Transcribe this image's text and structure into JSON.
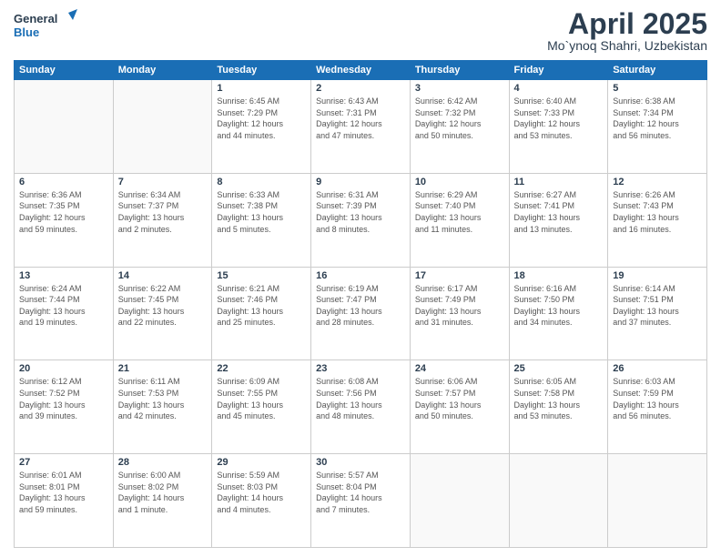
{
  "header": {
    "logo_line1": "General",
    "logo_line2": "Blue",
    "month": "April 2025",
    "location": "Mo`ynoq Shahri, Uzbekistan"
  },
  "weekdays": [
    "Sunday",
    "Monday",
    "Tuesday",
    "Wednesday",
    "Thursday",
    "Friday",
    "Saturday"
  ],
  "weeks": [
    [
      {
        "day": "",
        "info": ""
      },
      {
        "day": "",
        "info": ""
      },
      {
        "day": "1",
        "info": "Sunrise: 6:45 AM\nSunset: 7:29 PM\nDaylight: 12 hours\nand 44 minutes."
      },
      {
        "day": "2",
        "info": "Sunrise: 6:43 AM\nSunset: 7:31 PM\nDaylight: 12 hours\nand 47 minutes."
      },
      {
        "day": "3",
        "info": "Sunrise: 6:42 AM\nSunset: 7:32 PM\nDaylight: 12 hours\nand 50 minutes."
      },
      {
        "day": "4",
        "info": "Sunrise: 6:40 AM\nSunset: 7:33 PM\nDaylight: 12 hours\nand 53 minutes."
      },
      {
        "day": "5",
        "info": "Sunrise: 6:38 AM\nSunset: 7:34 PM\nDaylight: 12 hours\nand 56 minutes."
      }
    ],
    [
      {
        "day": "6",
        "info": "Sunrise: 6:36 AM\nSunset: 7:35 PM\nDaylight: 12 hours\nand 59 minutes."
      },
      {
        "day": "7",
        "info": "Sunrise: 6:34 AM\nSunset: 7:37 PM\nDaylight: 13 hours\nand 2 minutes."
      },
      {
        "day": "8",
        "info": "Sunrise: 6:33 AM\nSunset: 7:38 PM\nDaylight: 13 hours\nand 5 minutes."
      },
      {
        "day": "9",
        "info": "Sunrise: 6:31 AM\nSunset: 7:39 PM\nDaylight: 13 hours\nand 8 minutes."
      },
      {
        "day": "10",
        "info": "Sunrise: 6:29 AM\nSunset: 7:40 PM\nDaylight: 13 hours\nand 11 minutes."
      },
      {
        "day": "11",
        "info": "Sunrise: 6:27 AM\nSunset: 7:41 PM\nDaylight: 13 hours\nand 13 minutes."
      },
      {
        "day": "12",
        "info": "Sunrise: 6:26 AM\nSunset: 7:43 PM\nDaylight: 13 hours\nand 16 minutes."
      }
    ],
    [
      {
        "day": "13",
        "info": "Sunrise: 6:24 AM\nSunset: 7:44 PM\nDaylight: 13 hours\nand 19 minutes."
      },
      {
        "day": "14",
        "info": "Sunrise: 6:22 AM\nSunset: 7:45 PM\nDaylight: 13 hours\nand 22 minutes."
      },
      {
        "day": "15",
        "info": "Sunrise: 6:21 AM\nSunset: 7:46 PM\nDaylight: 13 hours\nand 25 minutes."
      },
      {
        "day": "16",
        "info": "Sunrise: 6:19 AM\nSunset: 7:47 PM\nDaylight: 13 hours\nand 28 minutes."
      },
      {
        "day": "17",
        "info": "Sunrise: 6:17 AM\nSunset: 7:49 PM\nDaylight: 13 hours\nand 31 minutes."
      },
      {
        "day": "18",
        "info": "Sunrise: 6:16 AM\nSunset: 7:50 PM\nDaylight: 13 hours\nand 34 minutes."
      },
      {
        "day": "19",
        "info": "Sunrise: 6:14 AM\nSunset: 7:51 PM\nDaylight: 13 hours\nand 37 minutes."
      }
    ],
    [
      {
        "day": "20",
        "info": "Sunrise: 6:12 AM\nSunset: 7:52 PM\nDaylight: 13 hours\nand 39 minutes."
      },
      {
        "day": "21",
        "info": "Sunrise: 6:11 AM\nSunset: 7:53 PM\nDaylight: 13 hours\nand 42 minutes."
      },
      {
        "day": "22",
        "info": "Sunrise: 6:09 AM\nSunset: 7:55 PM\nDaylight: 13 hours\nand 45 minutes."
      },
      {
        "day": "23",
        "info": "Sunrise: 6:08 AM\nSunset: 7:56 PM\nDaylight: 13 hours\nand 48 minutes."
      },
      {
        "day": "24",
        "info": "Sunrise: 6:06 AM\nSunset: 7:57 PM\nDaylight: 13 hours\nand 50 minutes."
      },
      {
        "day": "25",
        "info": "Sunrise: 6:05 AM\nSunset: 7:58 PM\nDaylight: 13 hours\nand 53 minutes."
      },
      {
        "day": "26",
        "info": "Sunrise: 6:03 AM\nSunset: 7:59 PM\nDaylight: 13 hours\nand 56 minutes."
      }
    ],
    [
      {
        "day": "27",
        "info": "Sunrise: 6:01 AM\nSunset: 8:01 PM\nDaylight: 13 hours\nand 59 minutes."
      },
      {
        "day": "28",
        "info": "Sunrise: 6:00 AM\nSunset: 8:02 PM\nDaylight: 14 hours\nand 1 minute."
      },
      {
        "day": "29",
        "info": "Sunrise: 5:59 AM\nSunset: 8:03 PM\nDaylight: 14 hours\nand 4 minutes."
      },
      {
        "day": "30",
        "info": "Sunrise: 5:57 AM\nSunset: 8:04 PM\nDaylight: 14 hours\nand 7 minutes."
      },
      {
        "day": "",
        "info": ""
      },
      {
        "day": "",
        "info": ""
      },
      {
        "day": "",
        "info": ""
      }
    ]
  ]
}
